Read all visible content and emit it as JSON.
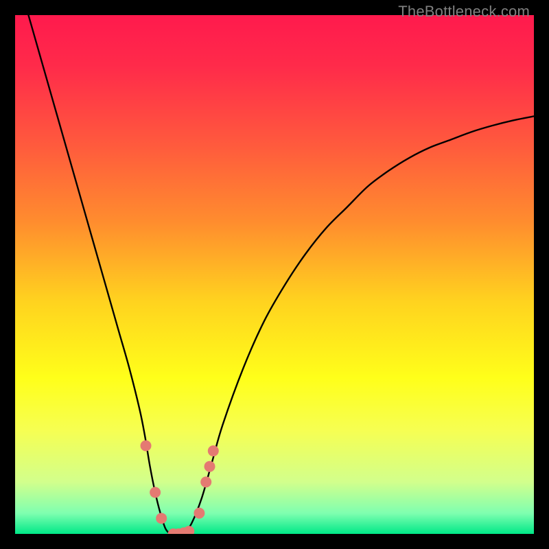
{
  "watermark": "TheBottleneck.com",
  "chart_data": {
    "type": "line",
    "title": "",
    "xlabel": "",
    "ylabel": "",
    "xlim": [
      0,
      100
    ],
    "ylim": [
      0,
      100
    ],
    "background_gradient": {
      "stops": [
        {
          "offset": 0.0,
          "color": "#ff1a4d"
        },
        {
          "offset": 0.1,
          "color": "#ff2b4a"
        },
        {
          "offset": 0.25,
          "color": "#ff5a3d"
        },
        {
          "offset": 0.4,
          "color": "#ff8d2e"
        },
        {
          "offset": 0.55,
          "color": "#ffd21f"
        },
        {
          "offset": 0.7,
          "color": "#ffff1a"
        },
        {
          "offset": 0.8,
          "color": "#f6ff52"
        },
        {
          "offset": 0.9,
          "color": "#d2ff8c"
        },
        {
          "offset": 0.96,
          "color": "#7fffb0"
        },
        {
          "offset": 1.0,
          "color": "#00e888"
        }
      ]
    },
    "series": [
      {
        "name": "bottleneck-curve",
        "x": [
          2,
          4,
          6,
          8,
          10,
          12,
          14,
          16,
          18,
          20,
          22,
          24,
          25,
          26,
          27,
          28,
          29,
          30,
          31,
          32,
          33,
          34,
          36,
          38,
          40,
          44,
          48,
          52,
          56,
          60,
          64,
          68,
          72,
          76,
          80,
          84,
          88,
          92,
          96,
          100
        ],
        "y": [
          102,
          95,
          88,
          81,
          74,
          67,
          60,
          53,
          46,
          39,
          32,
          24,
          19,
          13,
          8,
          4,
          1,
          0,
          0,
          0,
          1,
          2,
          7,
          14,
          21,
          32,
          41,
          48,
          54,
          59,
          63,
          67,
          70,
          72.5,
          74.5,
          76,
          77.5,
          78.7,
          79.7,
          80.5
        ]
      }
    ],
    "markers": {
      "name": "highlight-points",
      "color": "#e47a72",
      "radius": 8,
      "points": [
        {
          "x": 25.2,
          "y": 17
        },
        {
          "x": 27.0,
          "y": 8
        },
        {
          "x": 28.2,
          "y": 3
        },
        {
          "x": 30.5,
          "y": 0
        },
        {
          "x": 31.5,
          "y": 0
        },
        {
          "x": 32.5,
          "y": 0.2
        },
        {
          "x": 33.5,
          "y": 0.5
        },
        {
          "x": 35.5,
          "y": 4
        },
        {
          "x": 36.8,
          "y": 10
        },
        {
          "x": 37.5,
          "y": 13
        },
        {
          "x": 38.2,
          "y": 16
        }
      ]
    }
  }
}
